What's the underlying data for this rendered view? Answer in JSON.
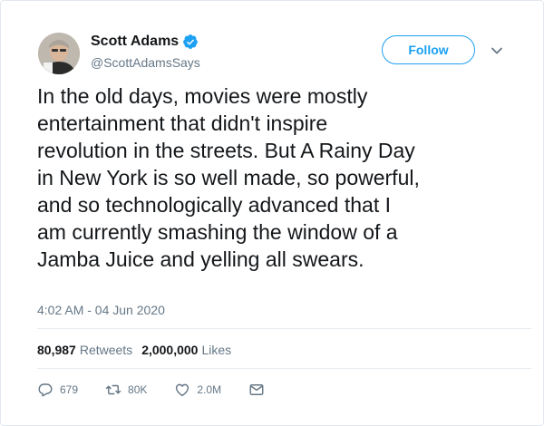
{
  "user": {
    "display_name": "Scott Adams",
    "handle": "@ScottAdamsSays",
    "verified": true
  },
  "follow": {
    "label": "Follow"
  },
  "tweet": {
    "text": "In the old days, movies were mostly\nentertainment that didn't inspire\nrevolution in the streets. But A Rainy Day\nin New York is so well made, so powerful,\nand so technologically advanced that I\nam currently smashing the window of a\nJamba Juice and yelling all swears.",
    "timestamp": "4:02 AM - 04 Jun 2020"
  },
  "stats": {
    "retweets_count": "80,987",
    "retweets_label": "Retweets",
    "likes_count": "2,000,000",
    "likes_label": "Likes"
  },
  "actions": {
    "reply_count": "679",
    "retweet_count": "80K",
    "like_count": "2.0M"
  },
  "colors": {
    "accent": "#1da1f2",
    "text_primary": "#14171a",
    "text_secondary": "#657786",
    "divider": "#e6ecf0"
  },
  "icons": [
    "verified-badge-icon",
    "chevron-down-icon",
    "reply-icon",
    "retweet-icon",
    "like-icon",
    "direct-message-icon"
  ]
}
